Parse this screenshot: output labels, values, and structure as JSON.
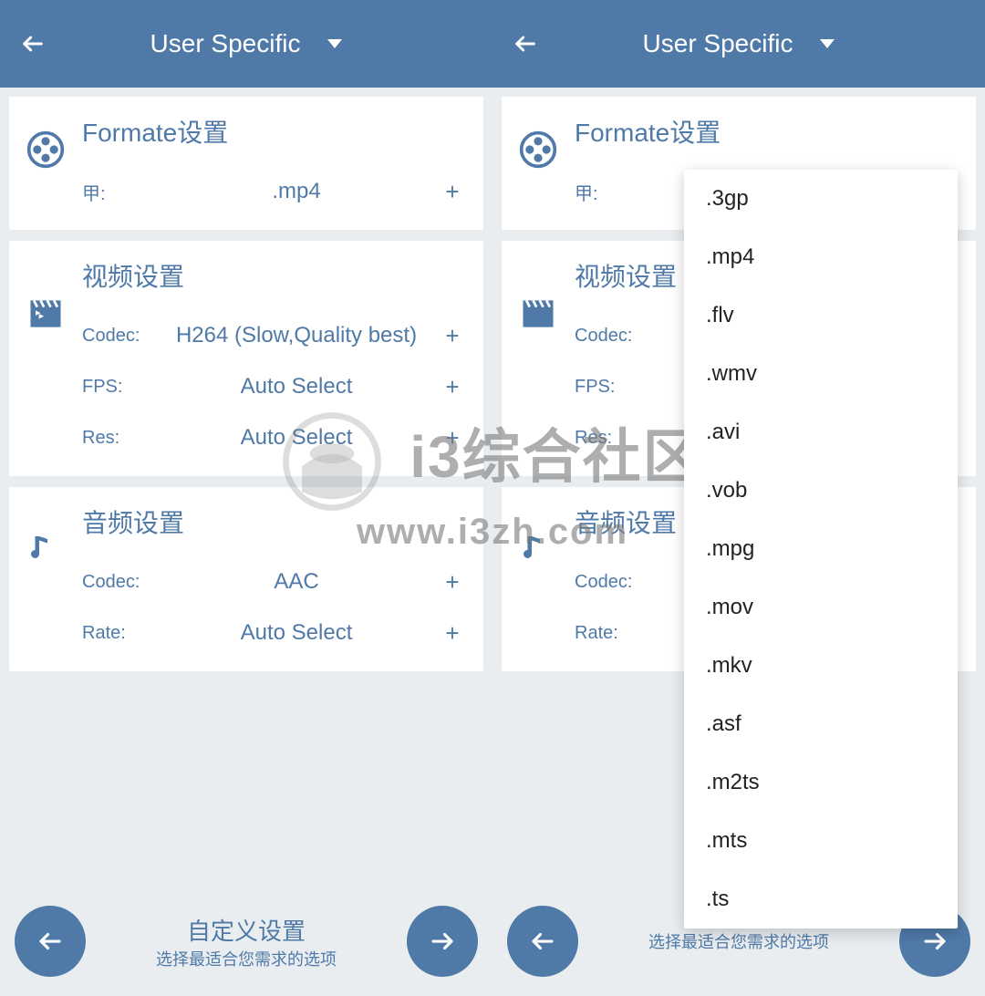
{
  "colors": {
    "primary": "#4f7aa8",
    "bg": "#e9edf0"
  },
  "appbar": {
    "title": "User Specific",
    "back_icon": "arrow-left",
    "dropdown_icon": "caret-down"
  },
  "sections": {
    "format": {
      "title": "Formate设置",
      "icon": "film-reel",
      "rows": [
        {
          "label": "甲:",
          "value": ".mp4"
        }
      ]
    },
    "video": {
      "title": "视频设置",
      "icon": "clapperboard",
      "rows": [
        {
          "label": "Codec:",
          "value": "H264 (Slow,Quality best)"
        },
        {
          "label": "FPS:",
          "value": "Auto Select"
        },
        {
          "label": "Res:",
          "value": "Auto Select"
        }
      ]
    },
    "audio": {
      "title": "音频设置",
      "icon": "music-note",
      "rows": [
        {
          "label": "Codec:",
          "value": "AAC"
        },
        {
          "label": "Rate:",
          "value": "Auto Select"
        }
      ]
    }
  },
  "bottom": {
    "title": "自定义设置",
    "subtitle": "选择最适合您需求的选项",
    "prev_icon": "arrow-left",
    "next_icon": "arrow-right"
  },
  "format_dropdown": {
    "options": [
      ".3gp",
      ".mp4",
      ".flv",
      ".wmv",
      ".avi",
      ".vob",
      ".mpg",
      ".mov",
      ".mkv",
      ".asf",
      ".m2ts",
      ".mts",
      ".ts"
    ]
  },
  "watermark": {
    "line1": "i3综合社区",
    "line2": "www.i3zh.com"
  }
}
